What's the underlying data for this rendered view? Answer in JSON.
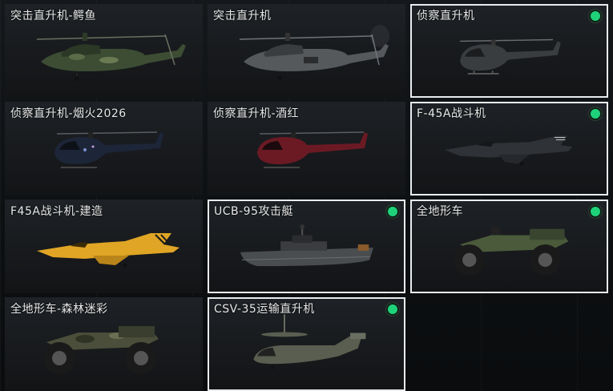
{
  "cards": [
    {
      "label": "突击直升机-鳄鱼",
      "selected": false,
      "equipped": false,
      "icon": "attack-helicopter-camo-icon",
      "accent": "#3c4d34"
    },
    {
      "label": "突击直升机",
      "selected": false,
      "equipped": false,
      "icon": "attack-helicopter-icon",
      "accent": "#55595c"
    },
    {
      "label": "侦察直升机",
      "selected": true,
      "equipped": true,
      "icon": "scout-helicopter-icon",
      "accent": "#3a3d40"
    },
    {
      "label": "侦察直升机-烟火2026",
      "selected": false,
      "equipped": false,
      "icon": "scout-helicopter-fireworks-icon",
      "accent": "#1d2538"
    },
    {
      "label": "侦察直升机-酒红",
      "selected": false,
      "equipped": false,
      "icon": "scout-helicopter-wine-red-icon",
      "accent": "#6b1a24"
    },
    {
      "label": "F-45A战斗机",
      "selected": true,
      "equipped": true,
      "icon": "fighter-jet-icon",
      "accent": "#2f3236"
    },
    {
      "label": "F45A战斗机-建造",
      "selected": false,
      "equipped": false,
      "icon": "fighter-jet-construction-icon",
      "accent": "#e0a524"
    },
    {
      "label": "UCB-95攻击艇",
      "selected": true,
      "equipped": true,
      "icon": "attack-boat-icon",
      "accent": "#4a4d50"
    },
    {
      "label": "全地形车",
      "selected": true,
      "equipped": true,
      "icon": "atv-icon",
      "accent": "#4a5a3a"
    },
    {
      "label": "全地形车-森林迷彩",
      "selected": false,
      "equipped": false,
      "icon": "atv-forest-camo-icon",
      "accent": "#4a4e3a"
    },
    {
      "label": "CSV-35运输直升机",
      "selected": true,
      "equipped": true,
      "icon": "transport-tiltrotor-icon",
      "accent": "#5a5e50"
    }
  ]
}
